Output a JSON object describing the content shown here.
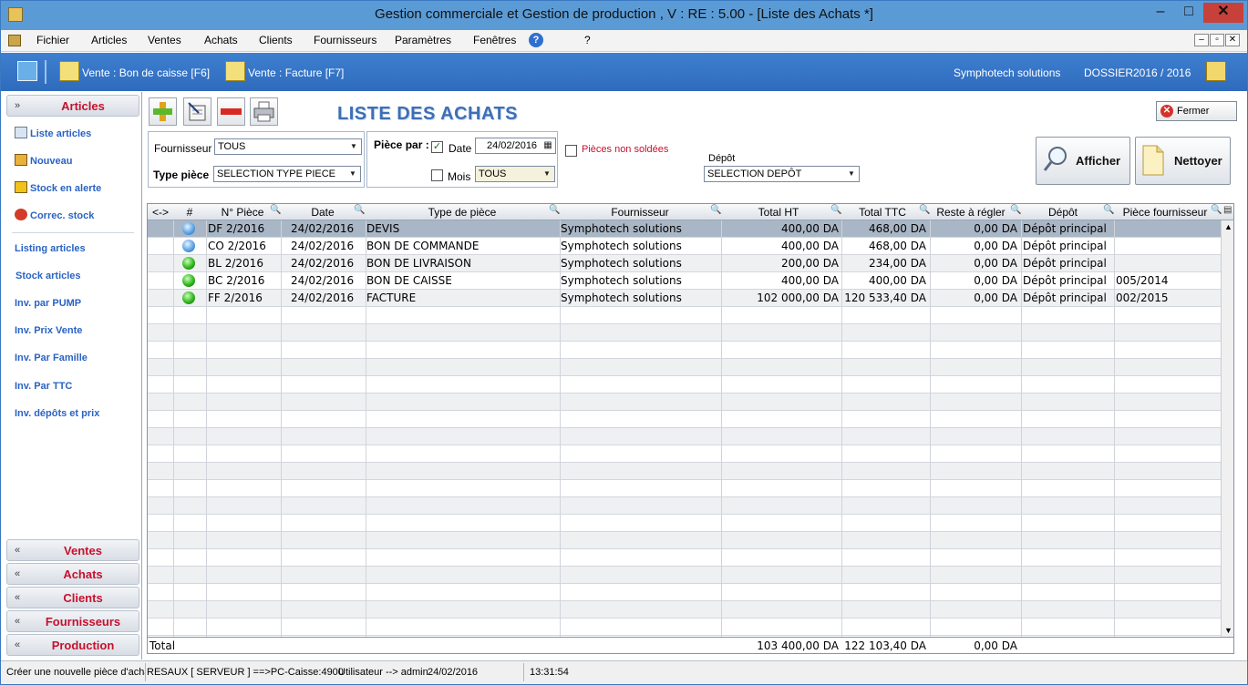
{
  "window": {
    "title": "Gestion commerciale et Gestion de production , V :  RE :  5.00 - [Liste des Achats *]",
    "minimize": "–",
    "maximize": "□",
    "close": "✕"
  },
  "menu": {
    "items": [
      "Fichier",
      "Articles",
      "Ventes",
      "Achats",
      "Clients",
      "Fournisseurs",
      "Paramètres",
      "Fenêtres"
    ],
    "help": "?",
    "question": "?"
  },
  "toolbar": {
    "shortcut1": "Vente : Bon de caisse [F6]",
    "shortcut2": "Vente : Facture [F7]",
    "company": "Symphotech solutions",
    "dossier": "DOSSIER2016 / 2016"
  },
  "left": {
    "articles_header": "Articles",
    "items": [
      "Liste articles",
      "Nouveau",
      "Stock en alerte",
      "Correc. stock"
    ],
    "links": [
      "Listing articles",
      "Stock articles",
      "Inv. par PUMP",
      "Inv.  Prix Vente",
      "Inv.  Par Famille",
      "Inv.  Par TTC",
      "Inv. dépôts et prix"
    ],
    "bottom_headers": [
      "Ventes",
      "Achats",
      "Clients",
      "Fournisseurs",
      "Production"
    ]
  },
  "main": {
    "title": "LISTE DES ACHATS",
    "close_label": "Fermer",
    "filters": {
      "fournisseur_label": "Fournisseur",
      "fournisseur_value": "TOUS",
      "type_label": "Type pièce",
      "type_value": "SELECTION TYPE PIECE",
      "piece_par_label": "Pièce par :",
      "date_label": "Date",
      "date_value": "24/02/2016",
      "date_checked": true,
      "mois_label": "Mois",
      "mois_value": "TOUS",
      "mois_checked": false,
      "non_soldees_label": "Pièces non soldées",
      "depot_label": "Dépôt",
      "depot_value": "SELECTION DEPÔT"
    },
    "afficher_label": "Afficher",
    "nettoyer_label": "Nettoyer"
  },
  "grid": {
    "headers": [
      "<->",
      "#",
      "N° Pièce",
      "Date",
      "Type de pièce",
      "Fournisseur",
      "Total HT",
      "Total TTC",
      "Reste à régler",
      "Dépôt",
      "Pièce fournisseur"
    ],
    "rows": [
      {
        "status": "blue",
        "num": "DF 2/2016",
        "date": "24/02/2016",
        "type": "DEVIS",
        "fournisseur": "Symphotech solutions",
        "ht": "400,00 DA",
        "ttc": "468,00 DA",
        "reste": "0,00 DA",
        "depot": "Dépôt principal",
        "piece": ""
      },
      {
        "status": "blue",
        "num": "CO 2/2016",
        "date": "24/02/2016",
        "type": "BON DE COMMANDE",
        "fournisseur": "Symphotech solutions",
        "ht": "400,00 DA",
        "ttc": "468,00 DA",
        "reste": "0,00 DA",
        "depot": "Dépôt principal",
        "piece": ""
      },
      {
        "status": "green",
        "num": "BL 2/2016",
        "date": "24/02/2016",
        "type": "BON DE LIVRAISON",
        "fournisseur": "Symphotech solutions",
        "ht": "200,00 DA",
        "ttc": "234,00 DA",
        "reste": "0,00 DA",
        "depot": "Dépôt principal",
        "piece": ""
      },
      {
        "status": "green",
        "num": "BC 2/2016",
        "date": "24/02/2016",
        "type": "BON DE CAISSE",
        "fournisseur": "Symphotech solutions",
        "ht": "400,00 DA",
        "ttc": "400,00 DA",
        "reste": "0,00 DA",
        "depot": "Dépôt principal",
        "piece": "005/2014"
      },
      {
        "status": "green",
        "num": "FF 2/2016",
        "date": "24/02/2016",
        "type": "FACTURE",
        "fournisseur": "Symphotech solutions",
        "ht": "102 000,00 DA",
        "ttc": "120 533,40 DA",
        "reste": "0,00 DA",
        "depot": "Dépôt principal",
        "piece": "002/2015"
      }
    ],
    "total_label": "Total",
    "total_ht": "103 400,00 DA",
    "total_ttc": "122 103,40 DA",
    "total_reste": "0,00 DA"
  },
  "status": {
    "hint": "Créer une nouvelle pièce d'achat",
    "network": "RESAUX [ SERVEUR ] ==>PC-Caisse:4900",
    "user": "Utilisateur -->  admin",
    "date": "24/02/2016",
    "time": "13:31:54"
  }
}
